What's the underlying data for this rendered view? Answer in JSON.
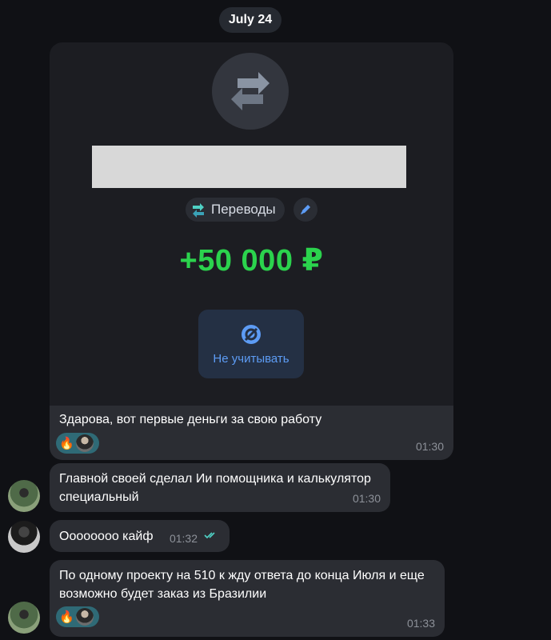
{
  "date_label": "July 24",
  "transaction": {
    "category_label": "Переводы",
    "amount": "+50 000 ₽",
    "ignore_label": "Не учитывать",
    "colors": {
      "amount": "#2bd34d",
      "ignore_text": "#5d9cf5",
      "category_icon": "#4fd1c5"
    }
  },
  "messages": [
    {
      "text": "Здарова, вот первые деньги за свою работу",
      "time": "01:30",
      "reaction": "🔥"
    },
    {
      "text": "Главной своей сделал Ии помощника и калькулятор специальный",
      "time": "01:30"
    },
    {
      "text": "Оооооооо кайф",
      "time": "01:32",
      "status": "read-double-check"
    },
    {
      "text": "По одному проекту на 510 к жду ответа до конца Июля и еще возможно будет заказ из Бразилии",
      "time": "01:33",
      "reaction": "🔥"
    }
  ]
}
